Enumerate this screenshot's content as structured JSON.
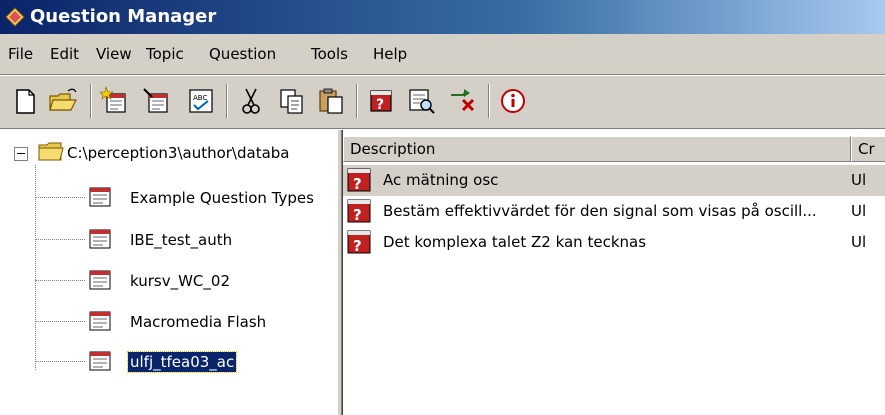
{
  "window": {
    "title": "Question Manager"
  },
  "menu": [
    "File",
    "Edit",
    "View",
    "Topic",
    "Question",
    "Tools",
    "Help"
  ],
  "toolbar": [
    "new-document-icon",
    "open-folder-icon",
    "new-topic-icon",
    "edit-topic-icon",
    "spell-check-icon",
    "cut-icon",
    "copy-icon",
    "paste-icon",
    "question-icon",
    "preview-icon",
    "remove-icon",
    "info-icon"
  ],
  "tree": {
    "root_label": "C:\\perception3\\author\\databa",
    "items": [
      {
        "label": "Example Question Types",
        "selected": false
      },
      {
        "label": "IBE_test_auth",
        "selected": false
      },
      {
        "label": "kursv_WC_02",
        "selected": false
      },
      {
        "label": "Macromedia Flash",
        "selected": false
      },
      {
        "label": "ulfj_tfea03_ac",
        "selected": true
      }
    ]
  },
  "list": {
    "columns": [
      "Description",
      "Cr"
    ],
    "rows": [
      {
        "description": "Ac mätning osc",
        "creator": "Ul",
        "selected": true
      },
      {
        "description": "Bestäm effektivvärdet för den signal som visas på oscill...",
        "creator": "Ul",
        "selected": false
      },
      {
        "description": "Det komplexa talet Z2 kan tecknas",
        "creator": "Ul",
        "selected": false
      }
    ]
  },
  "colors": {
    "title_bar_start": "#0a246a",
    "title_bar_end": "#a6caf0",
    "selection": "#0a246a",
    "face": "#d4d0c8"
  }
}
